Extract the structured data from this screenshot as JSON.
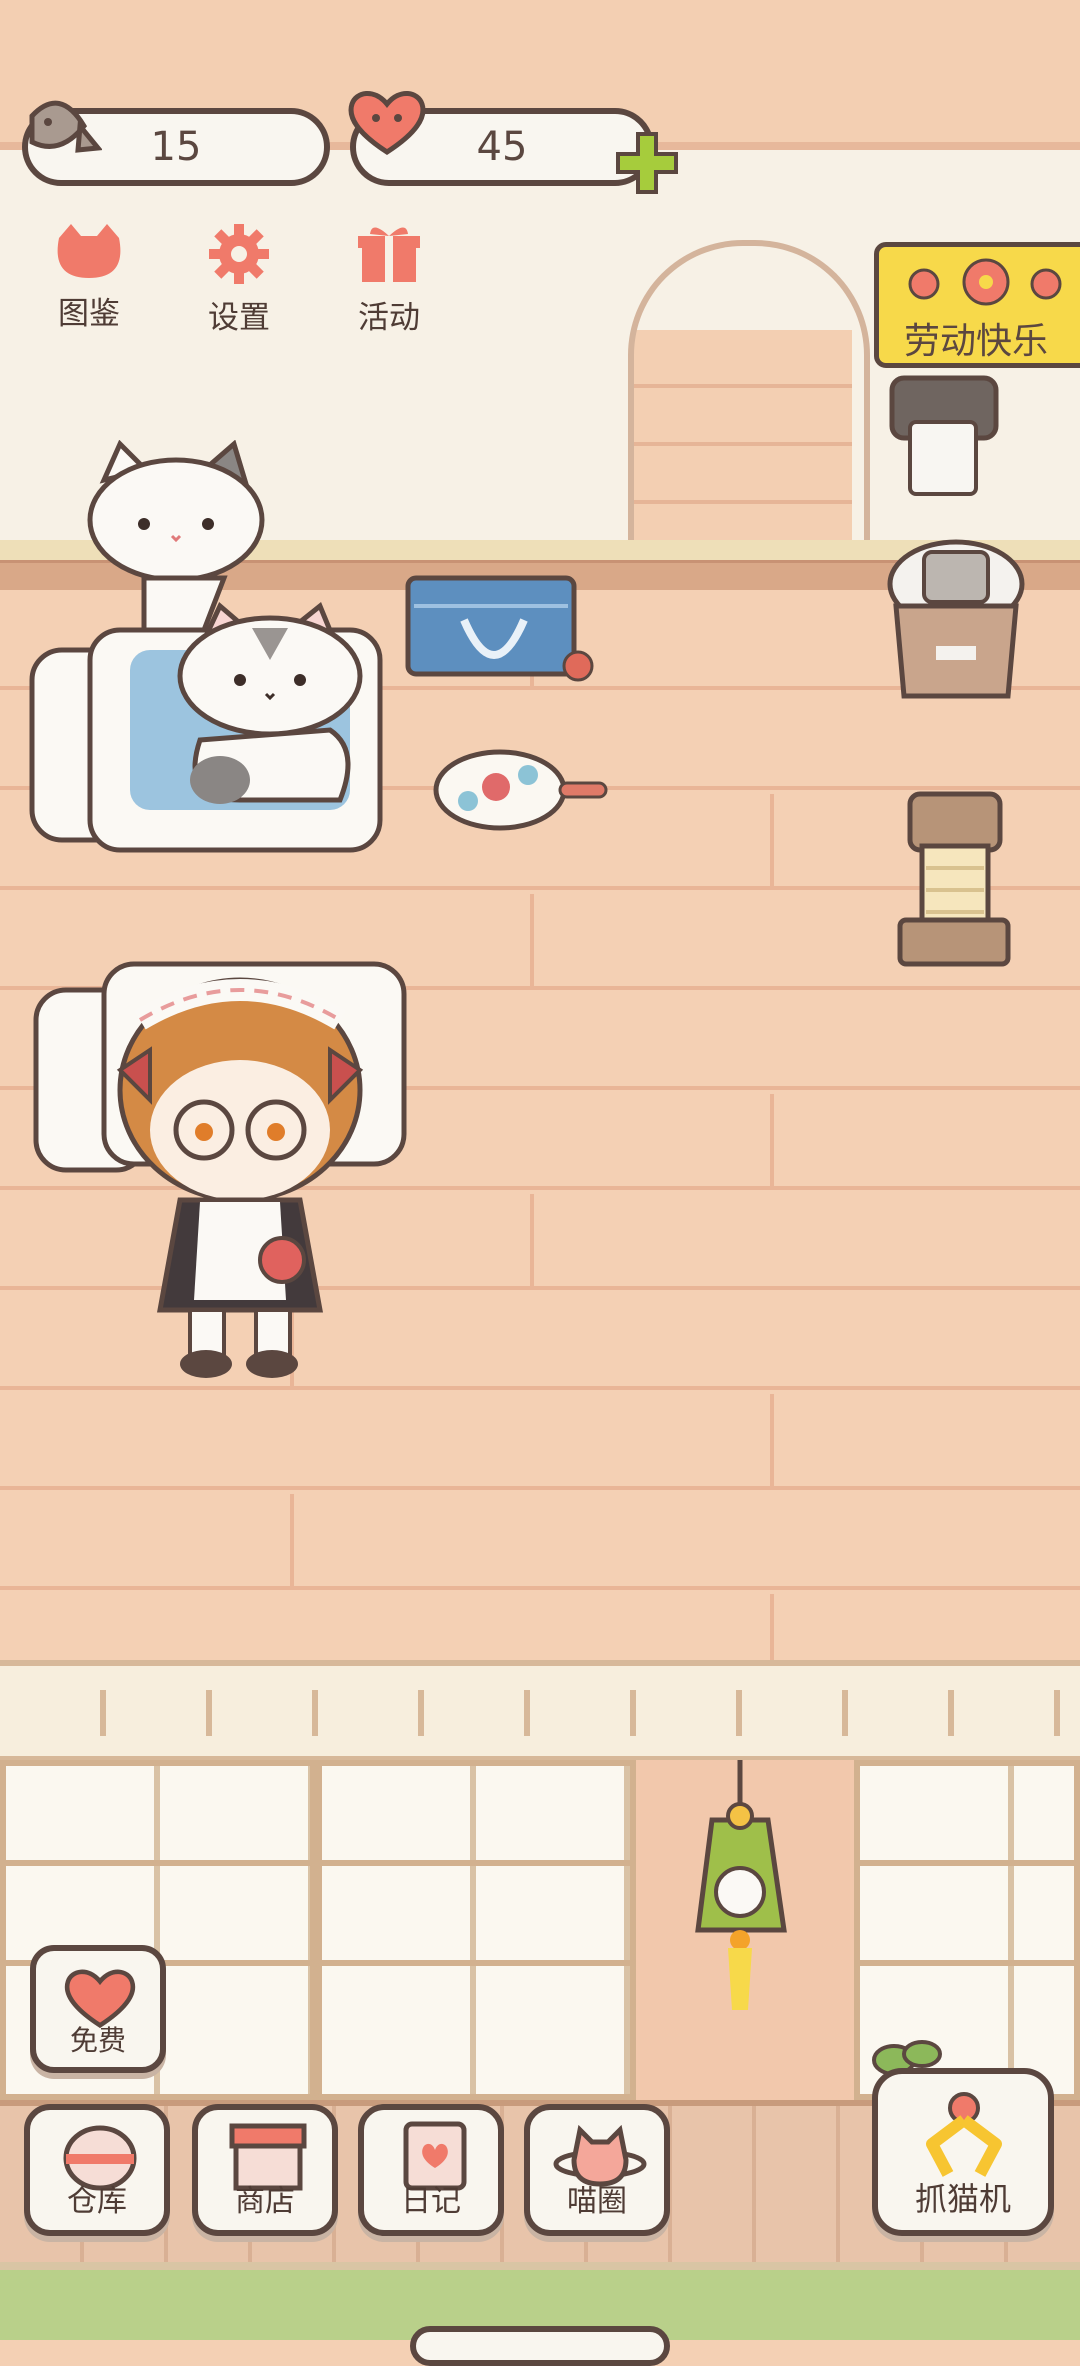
{
  "currency": {
    "fish_count": "15",
    "heart_count": "45",
    "fish_icon": "fish-icon",
    "heart_icon": "heart-icon",
    "add_icon": "plus-icon"
  },
  "top_menu": [
    {
      "label": "图鉴",
      "icon": "cat-face-icon"
    },
    {
      "label": "设置",
      "icon": "gear-icon"
    },
    {
      "label": "活动",
      "icon": "gift-icon"
    }
  ],
  "event_banner": {
    "label": "劳动快乐",
    "icon": "flower-icon"
  },
  "free_button": {
    "label": "免费",
    "icon": "heart-icon"
  },
  "bottom_nav": [
    {
      "label": "仓库",
      "icon": "storage-icon"
    },
    {
      "label": "商店",
      "icon": "shop-icon"
    },
    {
      "label": "日记",
      "icon": "diary-icon"
    },
    {
      "label": "喵圈",
      "icon": "planet-cat-icon"
    }
  ],
  "catch_button": {
    "label": "抓猫机",
    "icon": "claw-icon"
  },
  "colors": {
    "outline": "#5b4740",
    "accent_pink": "#f07a6a",
    "accent_green": "#a6cc3c",
    "banner_yellow": "#f7d94a",
    "floor": "#f4d0b4"
  }
}
